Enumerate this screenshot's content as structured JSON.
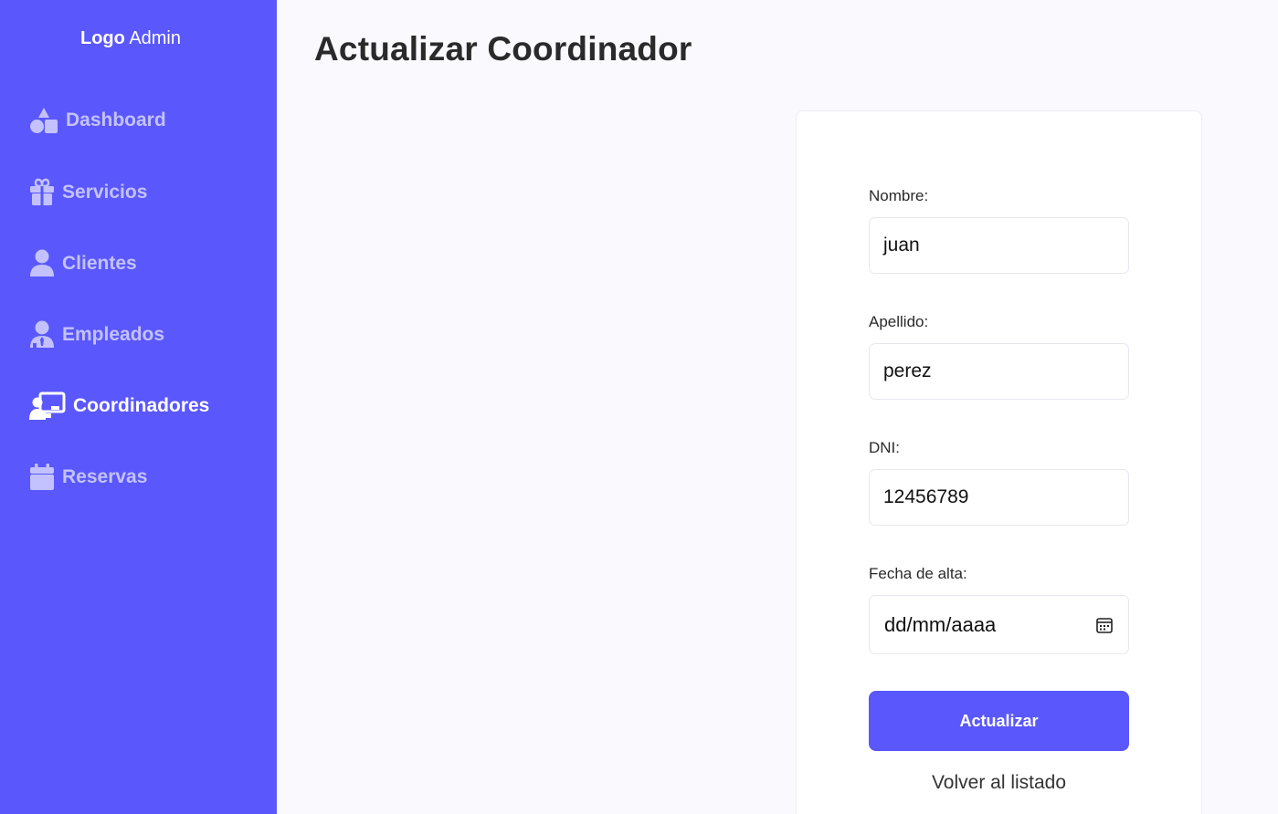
{
  "sidebar": {
    "logo_bold": "Logo",
    "logo_light": "Admin",
    "items": [
      {
        "label": "Dashboard",
        "icon": "shapes-icon",
        "active": false
      },
      {
        "label": "Servicios",
        "icon": "gift-icon",
        "active": false
      },
      {
        "label": "Clientes",
        "icon": "user-icon",
        "active": false
      },
      {
        "label": "Empleados",
        "icon": "user-tie-icon",
        "active": false
      },
      {
        "label": "Coordinadores",
        "icon": "chalkboard-user-icon",
        "active": true
      },
      {
        "label": "Reservas",
        "icon": "calendar-icon",
        "active": false
      }
    ]
  },
  "page": {
    "title": "Actualizar Coordinador"
  },
  "form": {
    "nombre_label": "Nombre:",
    "nombre_value": "juan",
    "apellido_label": "Apellido:",
    "apellido_value": "perez",
    "dni_label": "DNI:",
    "dni_value": "12456789",
    "fecha_label": "Fecha de alta:",
    "fecha_placeholder": "dd/mm/aaaa",
    "submit_label": "Actualizar",
    "back_label": "Volver al listado"
  },
  "colors": {
    "accent": "#5a57fd",
    "sidebar_inactive_text": "#c3c2ff",
    "background": "#f9f9fe"
  }
}
